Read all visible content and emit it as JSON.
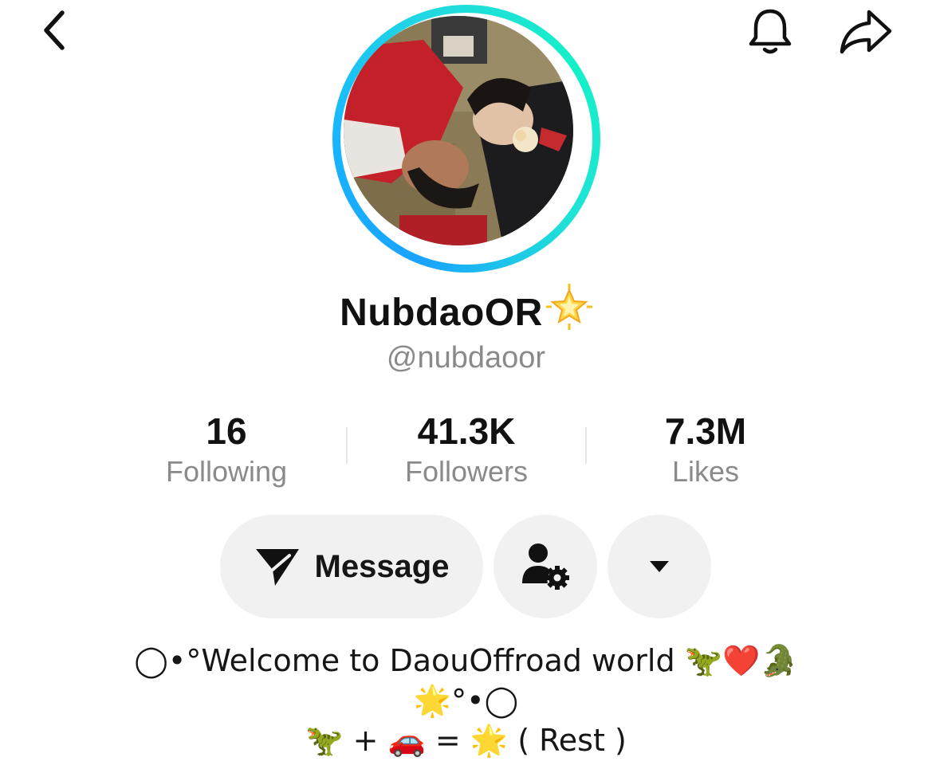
{
  "profile": {
    "display_name": "NubdaoOR",
    "name_emoji": "🌟",
    "handle": "@nubdaoor"
  },
  "stats": {
    "following": {
      "value": "16",
      "label": "Following"
    },
    "followers": {
      "value": "41.3K",
      "label": "Followers"
    },
    "likes": {
      "value": "7.3M",
      "label": "Likes"
    }
  },
  "actions": {
    "message_label": "Message"
  },
  "bio": {
    "line1": "◯•°Welcome to DaouOffroad world 🦖❤️🐊",
    "line2": "🌟°•◯",
    "line3": "🦖 + 🚗 = 🌟 ( Rest )"
  },
  "icons": {
    "back": "chevron-left-icon",
    "notifications": "bell-icon",
    "share": "share-arrow-icon",
    "message": "paper-plane-icon",
    "user_settings": "user-gear-icon",
    "more": "caret-down-icon"
  },
  "colors": {
    "ring_start": "#1aa3ff",
    "ring_end": "#15f0c8",
    "button_bg": "#f1f1f2",
    "secondary_text": "#8a8a8a"
  }
}
